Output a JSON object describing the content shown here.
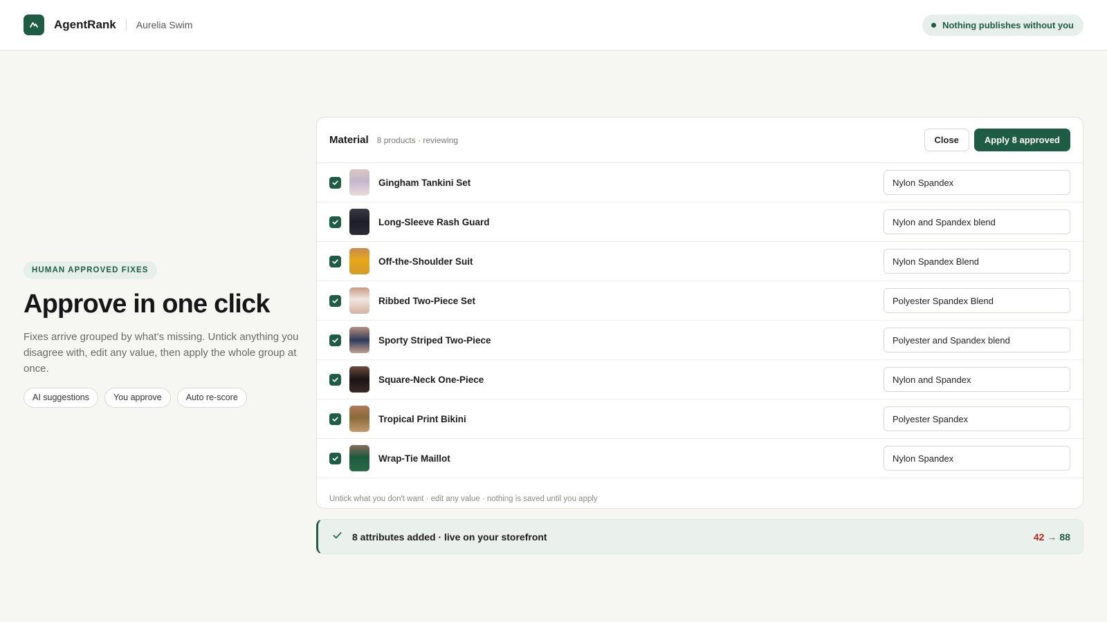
{
  "header": {
    "brand": "AgentRank",
    "store": "Aurelia Swim",
    "pill": "Nothing publishes without you",
    "logo_icon": "mountain-icon"
  },
  "hero": {
    "eyebrow": "HUMAN APPROVED FIXES",
    "title": "Approve in one click",
    "description": "Fixes arrive grouped by what’s missing. Untick anything you disagree with, edit any value, then apply the whole group at once.",
    "chips": [
      "AI suggestions",
      "You approve",
      "Auto re-score"
    ]
  },
  "review": {
    "title": "Material",
    "meta": "8 products · reviewing",
    "close_label": "Close",
    "apply_label": "Apply 8 approved",
    "items": [
      {
        "name": "Gingham Tankini Set",
        "value": "Nylon Spandex",
        "checked": true
      },
      {
        "name": "Long-Sleeve Rash Guard",
        "value": "Nylon and Spandex blend",
        "checked": true
      },
      {
        "name": "Off-the-Shoulder Suit",
        "value": "Nylon Spandex Blend",
        "checked": true
      },
      {
        "name": "Ribbed Two-Piece Set",
        "value": "Polyester Spandex Blend",
        "checked": true
      },
      {
        "name": "Sporty Striped Two-Piece",
        "value": "Polyester and Spandex blend",
        "checked": true
      },
      {
        "name": "Square-Neck One-Piece",
        "value": "Nylon and Spandex",
        "checked": true
      },
      {
        "name": "Tropical Print Bikini",
        "value": "Polyester Spandex",
        "checked": true
      },
      {
        "name": "Wrap-Tie Maillot",
        "value": "Nylon Spandex",
        "checked": true
      }
    ],
    "footnote": "Untick what you don't want · edit any value · nothing is saved until you apply"
  },
  "toast": {
    "message": "8 attributes added · live on your storefront",
    "score_before": "42",
    "arrow": "→",
    "score_after": "88"
  },
  "colors": {
    "accent": "#1f5c46",
    "accent_soft": "#e6efe9",
    "score_before": "#b3261e",
    "background": "#f6f6f2"
  }
}
